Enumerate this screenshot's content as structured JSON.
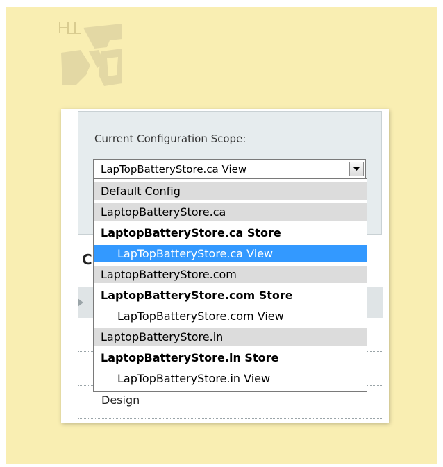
{
  "scope": {
    "label": "Current Configuration Scope:",
    "selected_value": "LapTopBatteryStore.ca View"
  },
  "dropdown": {
    "options": [
      {
        "label": "Default Config",
        "kind": "group"
      },
      {
        "label": "LaptopBatteryStore.ca",
        "kind": "group"
      },
      {
        "label": "LaptopBatteryStore.ca Store",
        "kind": "store"
      },
      {
        "label": "LapTopBatteryStore.ca View",
        "kind": "view",
        "selected": true
      },
      {
        "label": "LaptopBatteryStore.com",
        "kind": "group"
      },
      {
        "label": "LaptopBatteryStore.com Store",
        "kind": "store"
      },
      {
        "label": "LapTopBatteryStore.com View",
        "kind": "view"
      },
      {
        "label": "LaptopBatteryStore.in",
        "kind": "group"
      },
      {
        "label": "LaptopBatteryStore.in Store",
        "kind": "store"
      },
      {
        "label": "LapTopBatteryStore.in View",
        "kind": "view"
      }
    ]
  },
  "background": {
    "heading_partial": "C",
    "menu_item_design": "Design"
  },
  "colors": {
    "page_background": "#f9eeb2",
    "selected_highlight": "#3399ff",
    "group_background": "#dcdcdc"
  },
  "icons": {
    "logo": "belvg-logo",
    "select_arrow": "chevron-down-icon",
    "expand_arrow": "triangle-right-icon"
  }
}
